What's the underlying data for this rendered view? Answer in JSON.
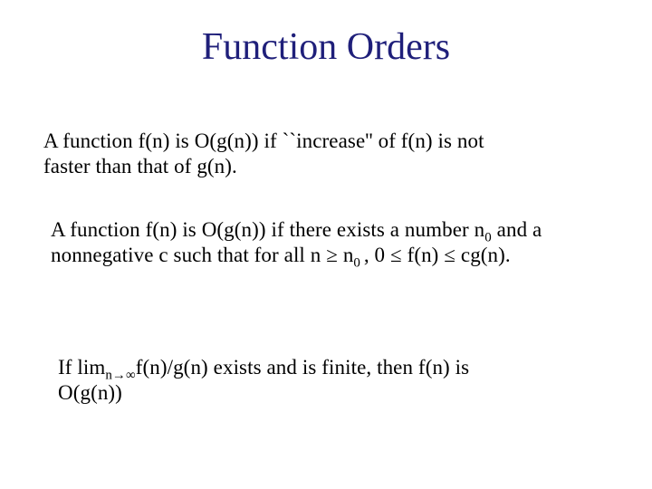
{
  "title": "Function Orders",
  "para1": {
    "line1": "A function f(n) is O(g(n)) if ``increase'' of f(n)  is  not",
    "line2": "faster than that of g(n)."
  },
  "para2": {
    "pre": "A function f(n) is O(g(n)) if there exists a number n",
    "sub1": "0",
    "mid1": "  and a nonnegative c such that for all n ",
    "geq1": "≥",
    "mid2": " n",
    "sub2": "0 ",
    "mid3": ",   0  ",
    "leq1": "≤",
    "mid4": "  f(n) ",
    "leq2": "≤",
    "mid5": " cg(n)."
  },
  "para3": {
    "pre": "  If lim",
    "sub_n": "n",
    "arrow": "→",
    "inf": "∞",
    "post1": "f(n)/g(n)   exists and is finite, then f(n) is",
    "post2": "O(g(n))"
  }
}
